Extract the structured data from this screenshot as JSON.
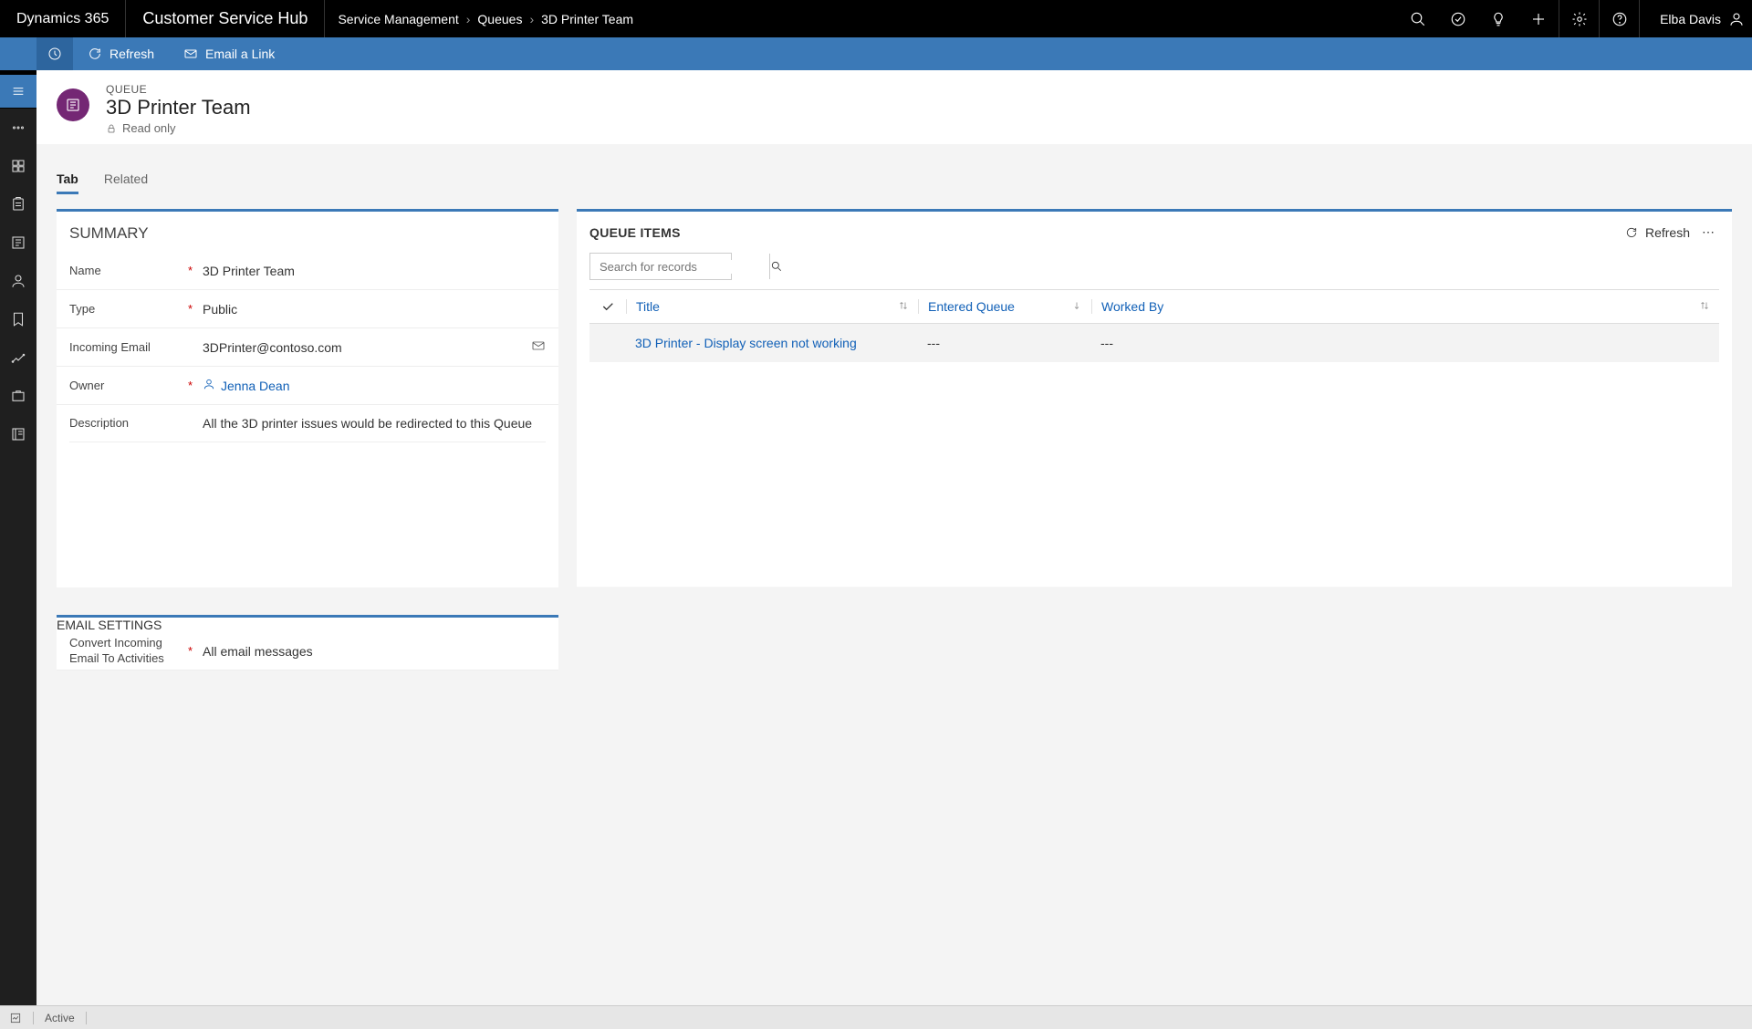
{
  "topbar": {
    "brand": "Dynamics 365",
    "hub": "Customer Service Hub",
    "breadcrumbs": [
      "Service Management",
      "Queues",
      "3D Printer Team"
    ],
    "user": "Elba Davis"
  },
  "cmdbar": {
    "refresh": "Refresh",
    "email_link": "Email a Link"
  },
  "header": {
    "entity_type": "QUEUE",
    "name": "3D Printer Team",
    "readonly": "Read only"
  },
  "tabs": [
    {
      "label": "Tab",
      "active": true
    },
    {
      "label": "Related",
      "active": false
    }
  ],
  "summary": {
    "title": "SUMMARY",
    "fields": {
      "name": {
        "label": "Name",
        "value": "3D Printer Team",
        "required": true
      },
      "type": {
        "label": "Type",
        "value": "Public",
        "required": true
      },
      "incoming_email": {
        "label": "Incoming Email",
        "value": "3DPrinter@contoso.com",
        "required": false
      },
      "owner": {
        "label": "Owner",
        "value": "Jenna Dean",
        "required": true
      },
      "description": {
        "label": "Description",
        "value": "All the 3D printer issues would be redirected to this Queue",
        "required": false
      }
    }
  },
  "email_settings": {
    "title": "EMAIL SETTINGS",
    "convert": {
      "label": "Convert Incoming Email To Activities",
      "value": "All email messages",
      "required": true
    }
  },
  "queue_items": {
    "title": "QUEUE ITEMS",
    "refresh": "Refresh",
    "search_placeholder": "Search for records",
    "columns": [
      "Title",
      "Entered Queue",
      "Worked By"
    ],
    "rows": [
      {
        "title": "3D Printer - Display screen not working",
        "entered": "---",
        "worked_by": "---"
      }
    ]
  },
  "footer": {
    "status": "Active"
  }
}
